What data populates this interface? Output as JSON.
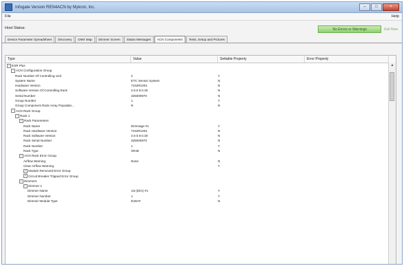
{
  "window": {
    "title": "Infogate Version REN4ACN by Mykron, Inc."
  },
  "controls": {
    "min": "–",
    "max": "□",
    "close": "×"
  },
  "menu": {
    "file": "File",
    "help": "Help"
  },
  "host": {
    "label": "Host Status:",
    "primary_btn": "No Errors or Warnings",
    "secondary_btn": "Exit Now"
  },
  "tabs": [
    "Device Parameter Spreadsheet",
    "Discovery",
    "DMX Map",
    "Dimmer Screen",
    "Status Messages",
    "ACN Components",
    "Tests, Setup and Pictures"
  ],
  "active_tab": 5,
  "table": {
    "headers": [
      "Type",
      "Value",
      "Settable Property",
      "Error Property"
    ],
    "rows": [
      {
        "indent": 0,
        "exp": "−",
        "type": "ESR Plus",
        "value": "",
        "set": "",
        "err": ""
      },
      {
        "indent": 1,
        "exp": "−",
        "type": "ACN Configuration Group",
        "value": "",
        "set": "",
        "err": ""
      },
      {
        "indent": 2,
        "exp": "",
        "type": "Rack Number Of Controlling Unit",
        "value": "2",
        "set": "Y",
        "err": ""
      },
      {
        "indent": 2,
        "exp": "",
        "type": "System Name",
        "value": "ETC Sensor System",
        "set": "N",
        "err": ""
      },
      {
        "indent": 2,
        "exp": "",
        "type": "Hardware Version",
        "value": "7152R1001",
        "set": "N",
        "err": ""
      },
      {
        "indent": 2,
        "exp": "",
        "type": "Software Version Of Controlling Rack",
        "value": "3.0.0.9.0.30",
        "set": "N",
        "err": ""
      },
      {
        "indent": 2,
        "exp": "",
        "type": "Serial Number",
        "value": "325000970",
        "set": "N",
        "err": ""
      },
      {
        "indent": 2,
        "exp": "",
        "type": "Group Number",
        "value": "1",
        "set": "Y",
        "err": ""
      },
      {
        "indent": 2,
        "exp": "",
        "type": "Group Component Rack Array Populatio...",
        "value": "N",
        "set": "N",
        "err": ""
      },
      {
        "indent": 1,
        "exp": "−",
        "type": "ACN Rack Group",
        "value": "",
        "set": "",
        "err": ""
      },
      {
        "indent": 2,
        "exp": "−",
        "type": "Rack 1",
        "value": "",
        "set": "",
        "err": ""
      },
      {
        "indent": 3,
        "exp": "−",
        "type": "Rack Parameters",
        "value": "",
        "set": "",
        "err": ""
      },
      {
        "indent": 4,
        "exp": "",
        "type": "Rack Name",
        "value": "Dimmage #1",
        "set": "Y",
        "err": ""
      },
      {
        "indent": 4,
        "exp": "",
        "type": "Rack Hardware Version",
        "value": "7152R1001",
        "set": "N",
        "err": ""
      },
      {
        "indent": 4,
        "exp": "",
        "type": "Rack Software Version",
        "value": "3.0.0.9.0.30",
        "set": "N",
        "err": ""
      },
      {
        "indent": 4,
        "exp": "",
        "type": "Rack Serial Number",
        "value": "325000970",
        "set": "N",
        "err": ""
      },
      {
        "indent": 4,
        "exp": "",
        "type": "Rack Number",
        "value": "1",
        "set": "Y",
        "err": ""
      },
      {
        "indent": 4,
        "exp": "",
        "type": "Rack Type",
        "value": "SR48",
        "set": "N",
        "err": ""
      },
      {
        "indent": 3,
        "exp": "−",
        "type": "ACN Rack Error Group",
        "value": "",
        "set": "",
        "err": ""
      },
      {
        "indent": 4,
        "exp": "",
        "type": "Airflow Warning",
        "value": "None",
        "set": "N",
        "err": ""
      },
      {
        "indent": 4,
        "exp": "",
        "type": "Clear Airflow Warning",
        "value": "",
        "set": "Y",
        "err": ""
      },
      {
        "indent": 4,
        "exp": "+",
        "type": "Module Removed Error Group",
        "value": "",
        "set": "",
        "err": ""
      },
      {
        "indent": 4,
        "exp": "+",
        "type": "Circuit Breaker Tripped Error Group",
        "value": "",
        "set": "",
        "err": ""
      },
      {
        "indent": 3,
        "exp": "−",
        "type": "Dimmers",
        "value": "",
        "set": "",
        "err": ""
      },
      {
        "indent": 4,
        "exp": "−",
        "type": "Dimmer 1",
        "value": "",
        "set": "",
        "err": ""
      },
      {
        "indent": 5,
        "exp": "",
        "type": "Dimmer Name",
        "value": "1st (Dim) #1",
        "set": "Y",
        "err": ""
      },
      {
        "indent": 5,
        "exp": "",
        "type": "Dimmer Number",
        "value": "1",
        "set": "Y",
        "err": ""
      },
      {
        "indent": 5,
        "exp": "",
        "type": "Dimmer Module Type",
        "value": "D20AF",
        "set": "N",
        "err": ""
      }
    ]
  },
  "scroll": {
    "up": "▲",
    "down": "▼"
  }
}
